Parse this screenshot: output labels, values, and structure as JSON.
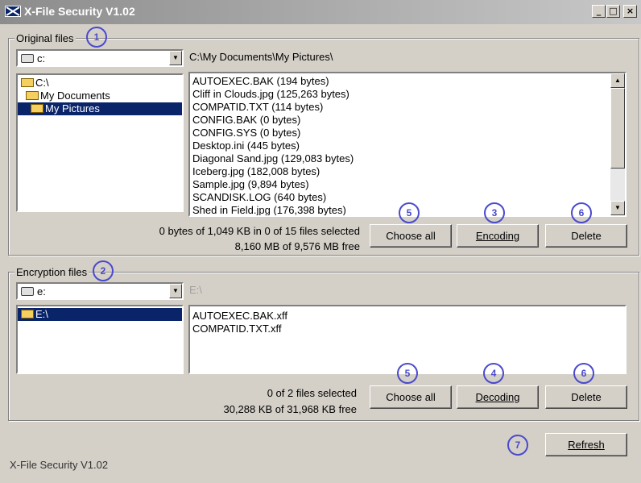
{
  "window": {
    "title": "X-File Security V1.02",
    "min_glyph": "_",
    "max_glyph": "□",
    "close_glyph": "×"
  },
  "original": {
    "legend": "Original files",
    "callout": "1",
    "drive": "c:",
    "path": "C:\\My Documents\\My Pictures\\",
    "tree": [
      {
        "label": "C:\\",
        "selected": false
      },
      {
        "label": "My Documents",
        "selected": false
      },
      {
        "label": "My Pictures",
        "selected": true
      }
    ],
    "files": [
      "AUTOEXEC.BAK  (194 bytes)",
      "Cliff in Clouds.jpg  (125,263 bytes)",
      "COMPATID.TXT  (114 bytes)",
      "CONFIG.BAK  (0 bytes)",
      "CONFIG.SYS  (0 bytes)",
      "Desktop.ini  (445 bytes)",
      "Diagonal Sand.jpg  (129,083 bytes)",
      "Iceberg.jpg  (182,008 bytes)",
      "Sample.jpg  (9,894 bytes)",
      "SCANDISK.LOG  (640 bytes)",
      "Shed in Field.jpg  (176,398 bytes)"
    ],
    "selected_info": "0 bytes of 1,049 KB in 0 of 15 files selected",
    "free_info": "8,160 MB of 9,576 MB free",
    "choose_all": "Choose all",
    "action": "Encoding",
    "delete": "Delete",
    "callout_choose": "5",
    "callout_action": "3",
    "callout_delete": "6"
  },
  "encrypted": {
    "legend": "Encryption files",
    "callout": "2",
    "drive": "e:",
    "path": "E:\\",
    "tree": [
      {
        "label": "E:\\",
        "selected": true
      }
    ],
    "files": [
      "AUTOEXEC.BAK.xff",
      "COMPATID.TXT.xff"
    ],
    "selected_info": "0 of 2 files selected",
    "free_info": "30,288 KB of 31,968 KB free",
    "choose_all": "Choose all",
    "action": "Decoding",
    "delete": "Delete",
    "callout_choose": "5",
    "callout_action": "4",
    "callout_delete": "6"
  },
  "footer": {
    "refresh": "Refresh",
    "callout_refresh": "7",
    "status": "X-File Security V1.02"
  }
}
